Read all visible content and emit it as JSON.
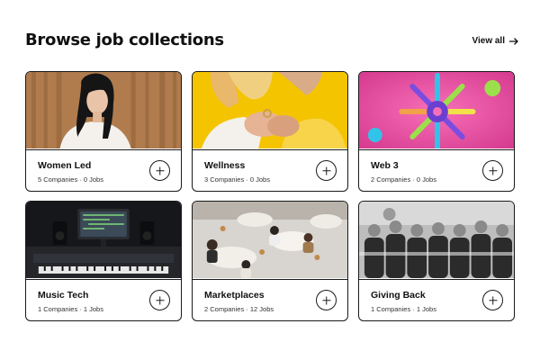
{
  "header": {
    "title": "Browse job collections",
    "view_all_label": "View all",
    "view_all_icon": "arrow-right-icon"
  },
  "collections": [
    {
      "title": "Women Led",
      "meta": "5 Companies · 0 Jobs",
      "image": "woman-portrait-photo",
      "action_icon": "plus-icon"
    },
    {
      "title": "Wellness",
      "meta": "3 Companies · 0 Jobs",
      "image": "couple-yellow-photo",
      "action_icon": "plus-icon"
    },
    {
      "title": "Web 3",
      "meta": "2 Companies · 0 Jobs",
      "image": "abstract-3d-photo",
      "action_icon": "plus-icon"
    },
    {
      "title": "Music Tech",
      "meta": "1 Companies · 1 Jobs",
      "image": "studio-desk-photo",
      "action_icon": "plus-icon"
    },
    {
      "title": "Marketplaces",
      "meta": "2 Companies · 12 Jobs",
      "image": "office-cafe-photo",
      "action_icon": "plus-icon"
    },
    {
      "title": "Giving Back",
      "meta": "1 Companies · 1 Jobs",
      "image": "team-group-photo",
      "action_icon": "plus-icon"
    }
  ],
  "colors": {
    "border": "#1a1a1a",
    "wellness_bg": "#f5c400",
    "web3_bg": "#e0419a"
  }
}
